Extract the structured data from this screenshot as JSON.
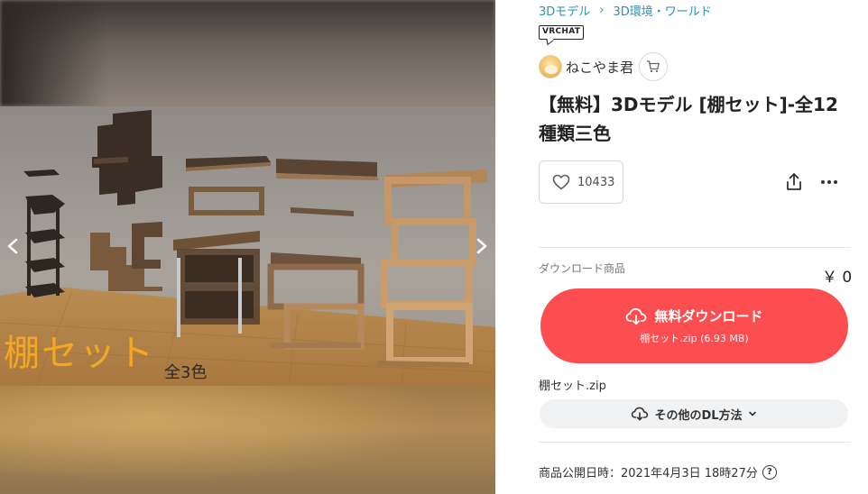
{
  "gallery": {
    "overlay_title": "棚セット",
    "overlay_subtitle": "全3色"
  },
  "breadcrumb": {
    "items": [
      "3Dモデル",
      "3D環境・ワールド"
    ]
  },
  "badge": {
    "label": "VRCHAT"
  },
  "shop": {
    "name": "ねこやま君"
  },
  "product": {
    "title": "【無料】3Dモデル [棚セット]-全12種類三色"
  },
  "actions": {
    "like_count": "10433"
  },
  "download": {
    "label": "ダウンロード商品",
    "price": "￥ 0",
    "button_label": "無料ダウンロード",
    "button_file": "棚セット.zip (6.93 MB)",
    "file_name": "棚セット.zip",
    "other_methods": "その他のDL方法"
  },
  "publish": {
    "text": "商品公開日時：2021年4月3日 18時27分"
  },
  "colors": {
    "accent": "#fc4d50",
    "link": "#2d8fb3",
    "overlay_title": "#f5a623"
  }
}
